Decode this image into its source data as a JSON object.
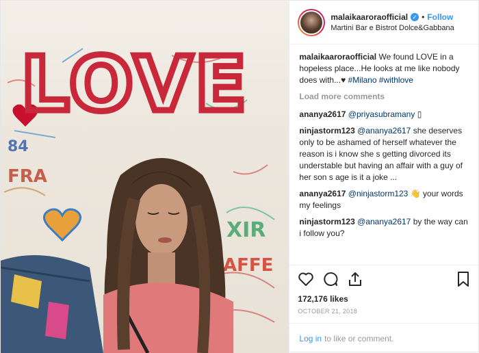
{
  "header": {
    "username": "malaikaaroraofficial",
    "verified_glyph": "✓",
    "separator": "•",
    "follow_label": "Follow",
    "location": "Martini Bar e Bistrot Dolce&Gabbana"
  },
  "caption": {
    "user": "malaikaaroraofficial",
    "text": "We found LOVE in a hopeless place...He looks at me like nobody does with...♥",
    "hashtags": "#Milano #withlove"
  },
  "load_more_label": "Load more comments",
  "comments": [
    {
      "user": "ananya2617",
      "mention": "@priyasubramany",
      "text": " ▯"
    },
    {
      "user": "ninjastorm123",
      "mention": "@ananya2617",
      "text": " she deserves only to be ashamed of herself whatever the reason is i know she s getting divorced its understable but having an affair with a guy of her son s age is it a joke ..."
    },
    {
      "user": "ananya2617",
      "mention": "@ninjastorm123",
      "text": " 👋 your words my feelings"
    },
    {
      "user": "ninjastorm123",
      "mention": "@ananya2617",
      "text": " by the way can i follow you?"
    }
  ],
  "actions": {
    "icons": [
      "heart-icon",
      "comment-icon",
      "share-icon",
      "bookmark-icon"
    ]
  },
  "likes": "172,176 likes",
  "date": "OCTOBER 21, 2018",
  "login": {
    "link": "Log in",
    "rest": "to like or comment."
  },
  "photo": {
    "wall_text": "LOVE"
  }
}
